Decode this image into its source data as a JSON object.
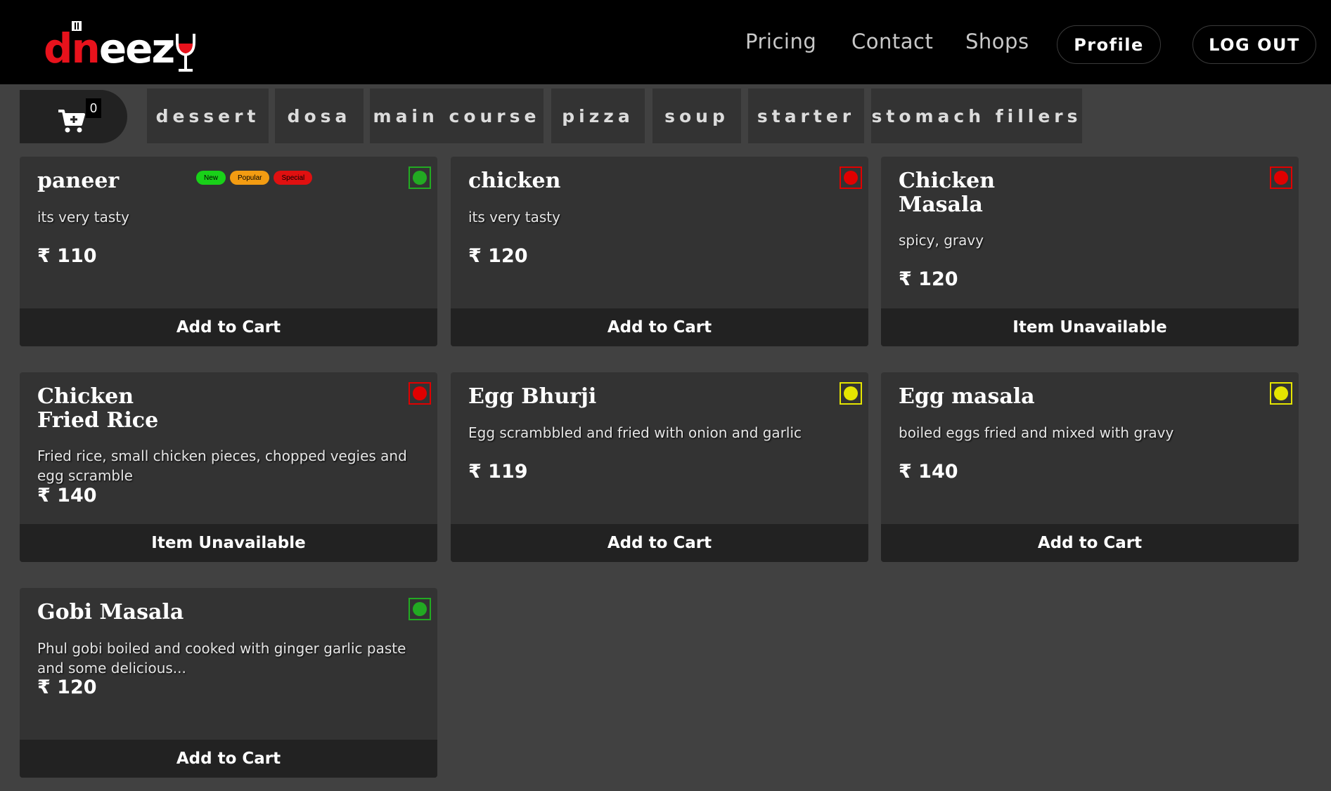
{
  "header": {
    "logo": {
      "part1": "dn",
      "part2": "eez",
      "part3": "y",
      "text": "dneezy"
    },
    "nav": [
      "Pricing",
      "Contact",
      "Shops"
    ],
    "profile_label": "Profile",
    "logout_label": "LOG OUT"
  },
  "cart": {
    "count": "0",
    "icon": "cart-plus-icon"
  },
  "categories": [
    "dessert",
    "dosa",
    "main course",
    "pizza",
    "soup",
    "starter",
    "stomach fillers"
  ],
  "colors": {
    "veg": "#22aa22",
    "non_veg": "#e00000",
    "egg": "#e5e500",
    "badge_new": "#19d119",
    "badge_popular": "#f39c12",
    "badge_special": "#e01010"
  },
  "items": [
    {
      "name": "paneer",
      "description": "its very tasty",
      "price": "₹ 110",
      "action": "Add to Cart",
      "type": "veg",
      "badges": [
        "New",
        "Popular",
        "Special"
      ]
    },
    {
      "name": "chicken",
      "description": "its very tasty",
      "price": "₹ 120",
      "action": "Add to Cart",
      "type": "non-veg"
    },
    {
      "name": "Chicken Masala",
      "description": "spicy, gravy",
      "price": "₹ 120",
      "action": "Item Unavailable",
      "type": "non-veg"
    },
    {
      "name": "Chicken Fried Rice",
      "description": "Fried rice, small chicken pieces, chopped vegies and egg scramble",
      "price": "₹ 140",
      "action": "Item Unavailable",
      "type": "non-veg"
    },
    {
      "name": "Egg Bhurji",
      "description": "Egg scrambbled and fried with onion and garlic",
      "price": "₹ 119",
      "action": "Add to Cart",
      "type": "egg"
    },
    {
      "name": "Egg masala",
      "description": "boiled eggs fried and mixed with gravy",
      "price": "₹ 140",
      "action": "Add to Cart",
      "type": "egg"
    },
    {
      "name": "Gobi Masala",
      "description": "Phul gobi boiled and cooked with ginger garlic paste and some delicious...",
      "price": "₹ 120",
      "action": "Add to Cart",
      "type": "veg"
    }
  ]
}
